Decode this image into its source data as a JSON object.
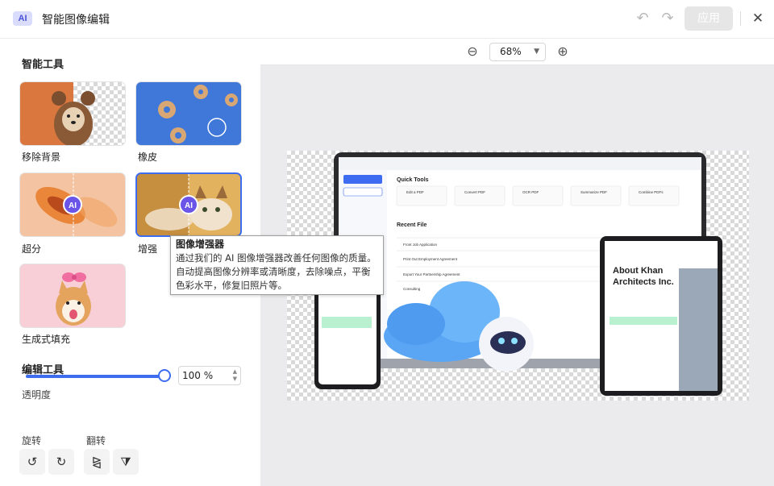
{
  "titlebar": {
    "badge": "AI",
    "title": "智能图像编辑",
    "apply_label": "应用"
  },
  "smart_tools": {
    "heading": "智能工具",
    "items": [
      {
        "label": "移除背景"
      },
      {
        "label": "橡皮"
      },
      {
        "label": "超分",
        "chip": "AI"
      },
      {
        "label": "增强",
        "chip": "AI"
      },
      {
        "label": "生成式填充"
      }
    ]
  },
  "tooltip": {
    "title": "图像增强器",
    "body": "通过我们的 AI 图像增强器改善任何图像的质量。自动提高图像分辨率或清晰度，去除噪点，平衡色彩水平，修复旧照片等。"
  },
  "edit_tools": {
    "heading": "编辑工具",
    "opacity_label": "透明度",
    "opacity_value": "100 %",
    "opacity_fraction": 1.0,
    "rotate_label": "旋转",
    "flip_label": "翻转"
  },
  "zoom": {
    "value": "68%"
  },
  "preview": {
    "laptop": {
      "quick_tools_title": "Quick Tools",
      "recent_title": "Recent File",
      "tools": [
        "Edit a PDF",
        "Convert PDF",
        "OCR PDF",
        "Summarize PDF",
        "Combine PDFs"
      ],
      "files": [
        "Front Job Application",
        "Print Out Employment Agreement",
        "Export Your Partnership Agreement",
        "Consulting"
      ]
    },
    "tablet": {
      "heading_line1": "About Khan",
      "heading_line2": "Architects Inc."
    }
  },
  "colors": {
    "accent": "#3d6cf0",
    "ai_purple": "#6a55e8",
    "canvas_bg": "#ebebed"
  }
}
